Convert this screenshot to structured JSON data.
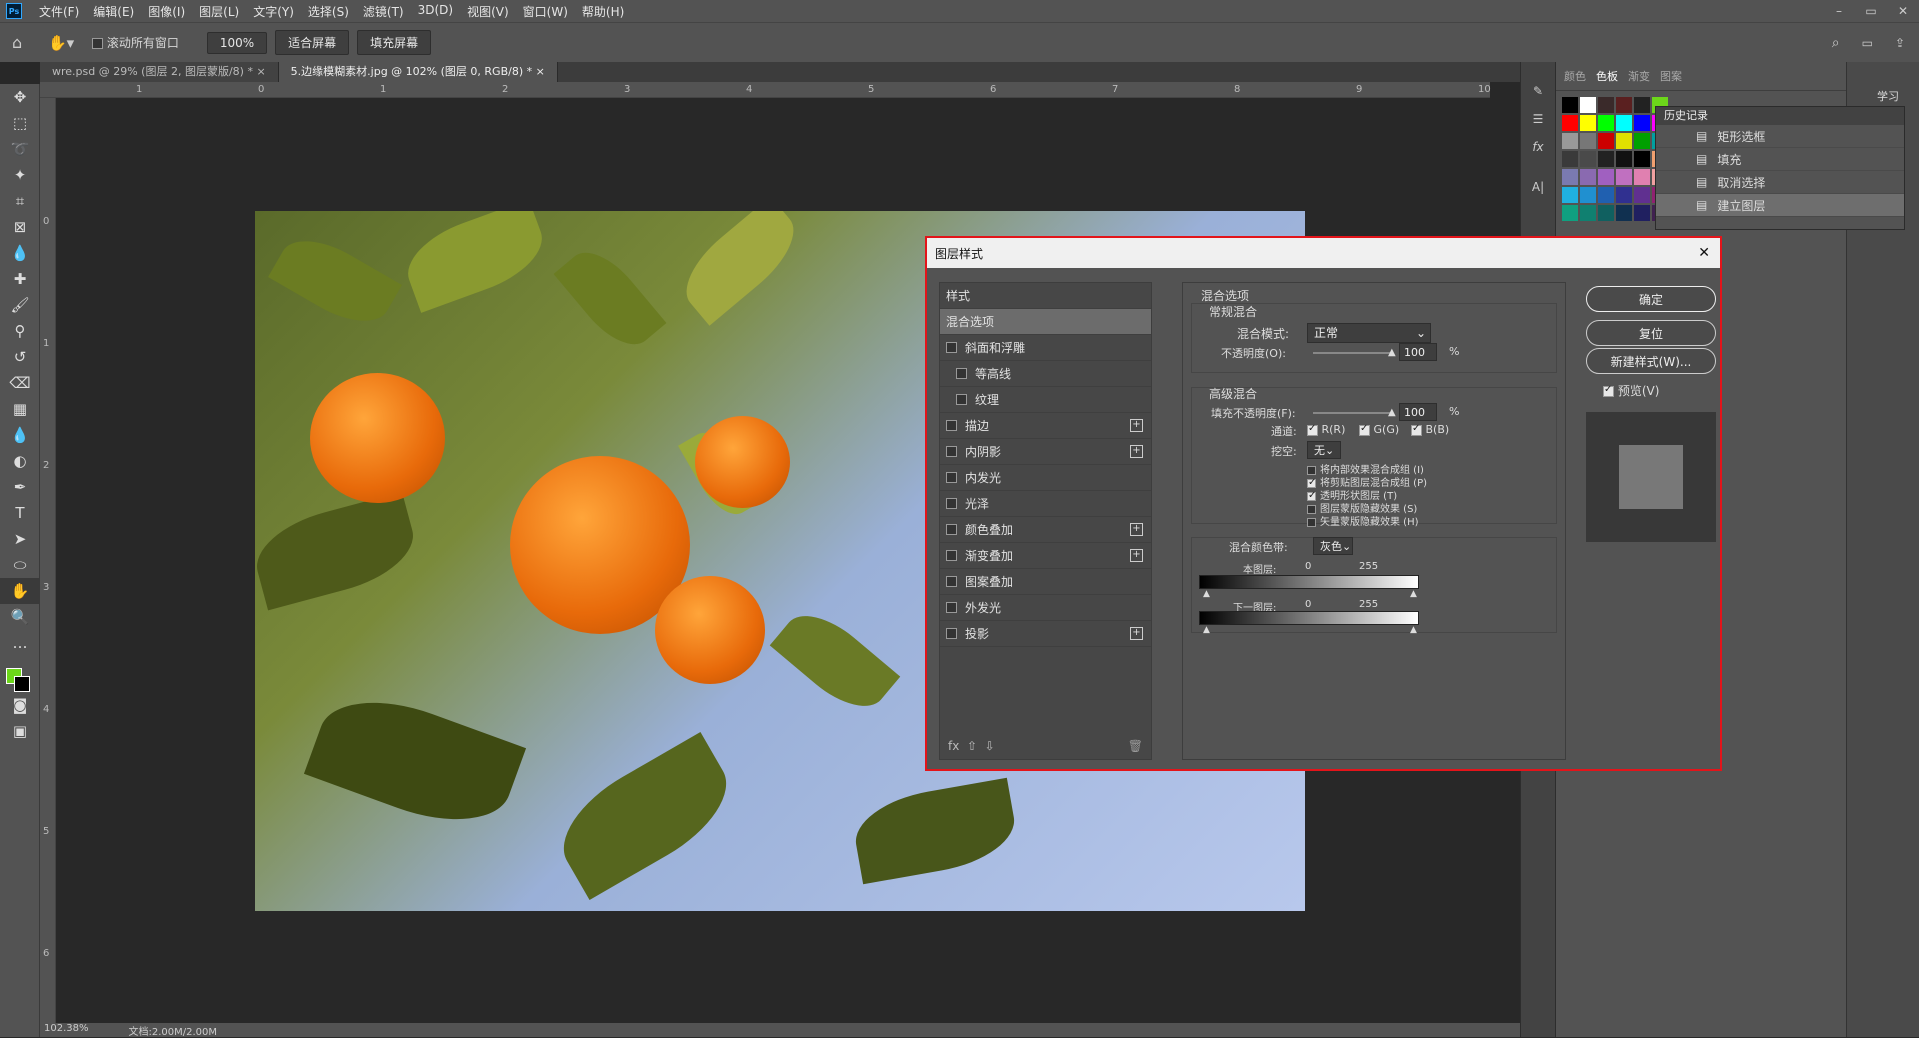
{
  "menu": {
    "logo": "Ps",
    "items": [
      "文件(F)",
      "编辑(E)",
      "图像(I)",
      "图层(L)",
      "文字(Y)",
      "选择(S)",
      "滤镜(T)",
      "3D(D)",
      "视图(V)",
      "窗口(W)",
      "帮助(H)"
    ],
    "win": [
      "–",
      "▭",
      "✕"
    ]
  },
  "options": {
    "scroll_all": "滚动所有窗口",
    "zoom": "100%",
    "fit": "适合屏幕",
    "fill": "填充屏幕"
  },
  "tabs": [
    "wre.psd @ 29% (图层 2, 图层蒙版/8) *",
    "5.边缘模糊素材.jpg @ 102% (图层 0, RGB/8) *"
  ],
  "ruler": {
    "h": [
      "1",
      "0",
      "1",
      "2",
      "3",
      "4",
      "5",
      "6",
      "7",
      "8",
      "9",
      "10"
    ],
    "v": [
      "0",
      "1",
      "2",
      "3",
      "4",
      "5",
      "6"
    ]
  },
  "status": {
    "zoom": "102.38%",
    "doc": "文档:2.00M/2.00M"
  },
  "panel": {
    "tabs": [
      "颜色",
      "色板",
      "渐变",
      "图案"
    ],
    "learn": "学习"
  },
  "swatches": [
    "#000000",
    "#ffffff",
    "#3a2a2a",
    "#5a2020",
    "#222222",
    "#6cd61a",
    "#ff0000",
    "#ffff00",
    "#00ff00",
    "#00ffff",
    "#0000ff",
    "#ff00ff",
    "#999999",
    "#777777",
    "#cc0000",
    "#e0e000",
    "#00a000",
    "#00a0a0",
    "#3a3a3a",
    "#4a4a4a",
    "#222222",
    "#111111",
    "#000000",
    "#f0a070",
    "#7a7ab0",
    "#8a6ab0",
    "#a060c0",
    "#c070c0",
    "#e080b0",
    "#f0a0a0",
    "#20b0e0",
    "#2090d0",
    "#2060b0",
    "#303090",
    "#603090",
    "#902070",
    "#10a080",
    "#108070",
    "#106060",
    "#103050",
    "#202060",
    "#402050"
  ],
  "history": {
    "title": "历史记录",
    "items": [
      "矩形选框",
      "填充",
      "取消选择",
      "建立图层"
    ]
  },
  "dialog": {
    "title": "图层样式",
    "close": "✕",
    "styles_header": "样式",
    "styles": [
      {
        "label": "混合选项",
        "sel": true,
        "chk": false,
        "plus": false
      },
      {
        "label": "斜面和浮雕",
        "chk": true,
        "plus": false
      },
      {
        "label": "等高线",
        "chk": true,
        "plus": false,
        "sub": true
      },
      {
        "label": "纹理",
        "chk": true,
        "plus": false,
        "sub": true
      },
      {
        "label": "描边",
        "chk": true,
        "plus": true
      },
      {
        "label": "内阴影",
        "chk": true,
        "plus": true
      },
      {
        "label": "内发光",
        "chk": true,
        "plus": false
      },
      {
        "label": "光泽",
        "chk": true,
        "plus": false
      },
      {
        "label": "颜色叠加",
        "chk": true,
        "plus": true
      },
      {
        "label": "渐变叠加",
        "chk": true,
        "plus": true
      },
      {
        "label": "图案叠加",
        "chk": true,
        "plus": false
      },
      {
        "label": "外发光",
        "chk": true,
        "plus": false
      },
      {
        "label": "投影",
        "chk": true,
        "plus": true
      }
    ],
    "blend_title": "混合选项",
    "normal": "常规混合",
    "mode_label": "混合模式:",
    "mode": "正常",
    "opacity_label": "不透明度(O):",
    "opacity": "100",
    "pct": "%",
    "advanced": "高级混合",
    "fill_label": "填充不透明度(F):",
    "fill": "100",
    "channels_label": "通道:",
    "r": "R(R)",
    "g": "G(G)",
    "b": "B(B)",
    "knockout_label": "挖空:",
    "knockout": "无",
    "opts": [
      {
        "label": "将内部效果混合成组 (I)",
        "on": false
      },
      {
        "label": "将剪贴图层混合成组 (P)",
        "on": true
      },
      {
        "label": "透明形状图层 (T)",
        "on": true
      },
      {
        "label": "图层蒙版隐藏效果 (S)",
        "on": false
      },
      {
        "label": "矢量蒙版隐藏效果 (H)",
        "on": false
      }
    ],
    "band_label": "混合颜色带:",
    "band": "灰色",
    "this_layer": "本图层:",
    "below_layer": "下一图层:",
    "v0": "0",
    "v255": "255",
    "ok": "确定",
    "reset": "复位",
    "new_style": "新建样式(W)...",
    "preview": "预览(V)"
  }
}
